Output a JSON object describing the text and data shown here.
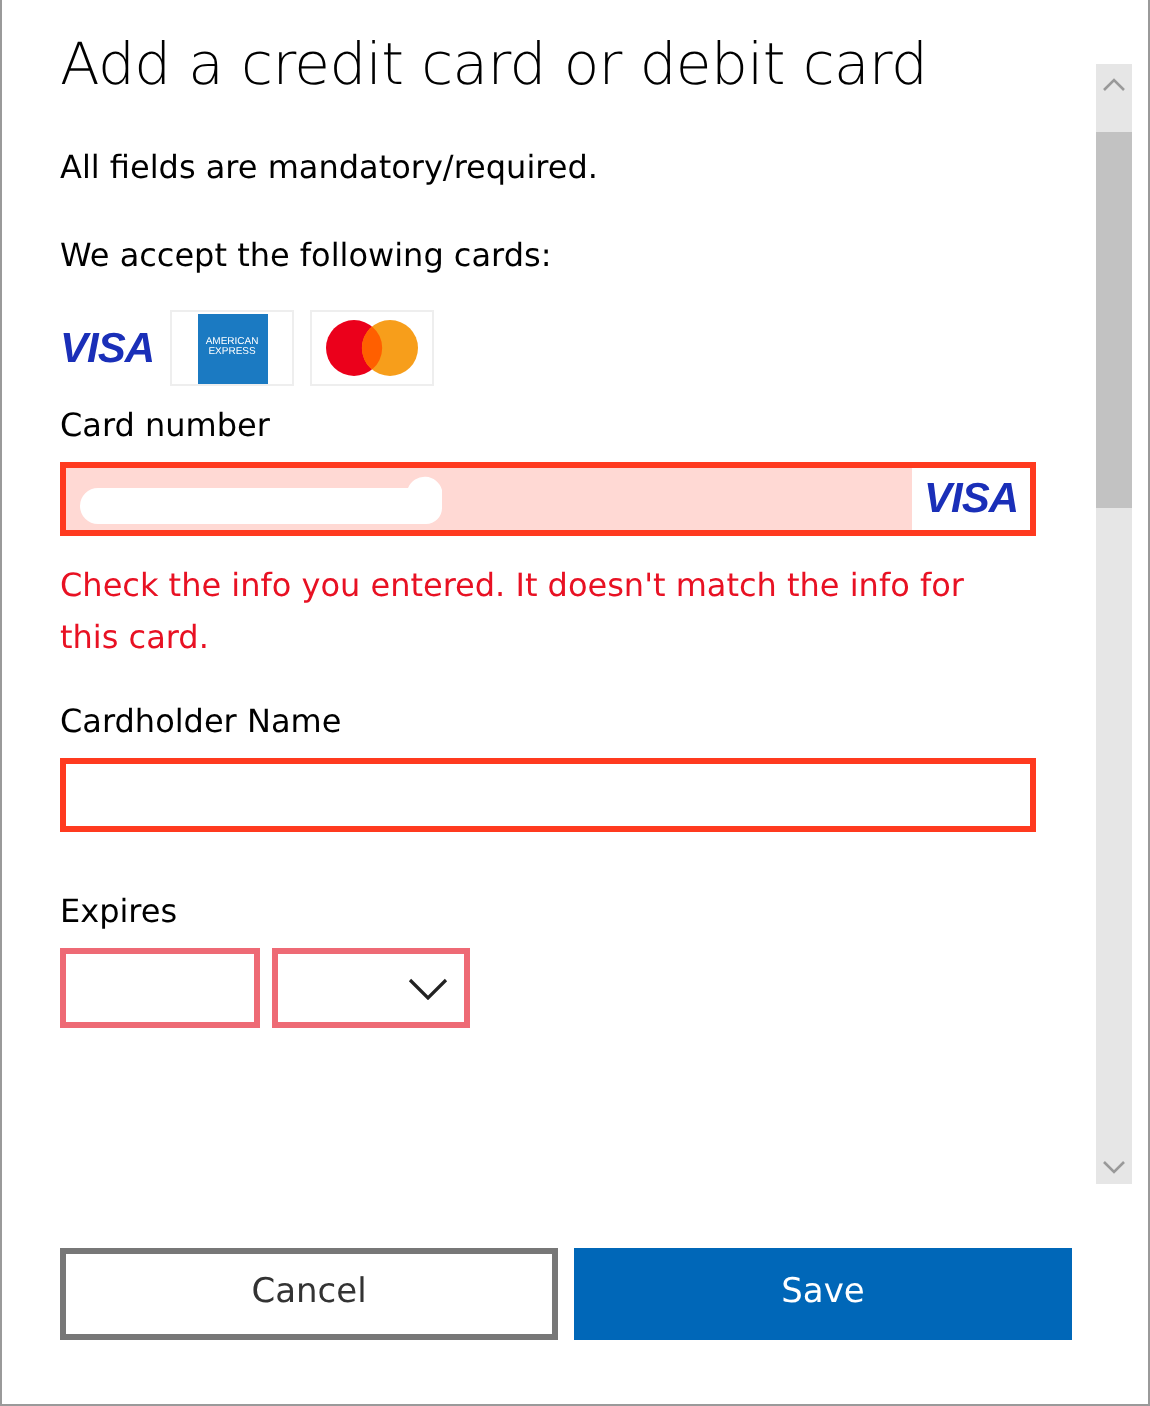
{
  "title": "Add a credit card or debit card",
  "note": "All fields are mandatory/required.",
  "accept_label": "We accept the following cards:",
  "card_logos": [
    {
      "kind": "visa",
      "text": "VISA"
    },
    {
      "kind": "amex",
      "text": "AMERICAN EXPRESS"
    },
    {
      "kind": "mastercard"
    }
  ],
  "card_number": {
    "label": "Card number",
    "invalid": true,
    "value_redacted": true,
    "detected": "VISA",
    "error": "Check the info you entered. It doesn't match the info for this card."
  },
  "cardholder": {
    "label": "Cardholder Name",
    "invalid": true
  },
  "expires": {
    "label": "Expires",
    "invalid": true,
    "fields": [
      {
        "kind": "text"
      },
      {
        "kind": "dropdown"
      }
    ]
  },
  "buttons": [
    {
      "label": "Cancel",
      "kind": "secondary"
    },
    {
      "label": "Save",
      "kind": "primary"
    }
  ]
}
